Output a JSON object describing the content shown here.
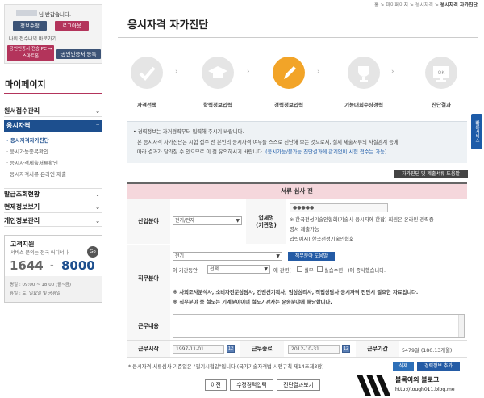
{
  "breadcrumb": [
    "홈",
    "마이페이지",
    "응시자격",
    "응시자격 자가진단"
  ],
  "sidebar": {
    "greeting_name": "●●●●●",
    "greeting_text": "님 반갑습니다.",
    "btn_edit_info": "정보수정",
    "btn_logout": "로그아웃",
    "recent_link": "나의 접수내역 바로가기",
    "btn_cert_transfer": "공인인증서 전송 PC → 스마트폰",
    "btn_cert_register": "공인인증서 등록",
    "mypage_title": "마이페이지",
    "menus": [
      {
        "label": "원서접수관리",
        "chev": "⌄"
      },
      {
        "label": "응시자격",
        "chev": "⌃"
      },
      {
        "label": "발급조회현황",
        "chev": "⌄"
      },
      {
        "label": "면제정보보기",
        "chev": "⌄"
      },
      {
        "label": "개인정보관리",
        "chev": "⌄"
      }
    ],
    "submenu": [
      "응시자격자가진단",
      "응시가능종목확인",
      "응시자격제출서류확인",
      "응시자격서류 온라인 제출"
    ],
    "cs_title": "고객지원",
    "cs_desc": "서비스 문의는 전국 어디서나",
    "cs_phone_a": "1644",
    "cs_phone_sep": "-",
    "cs_phone_b": "8000",
    "cs_badge": "Go",
    "cs_hours1": "평일 : 09:00 ~ 18:00 (월~금)",
    "cs_hours2": "휴일 : 토, 일요일 및 공휴일"
  },
  "page_title": "응시자격 자가진단",
  "steps": [
    {
      "label": "자격선택",
      "icon": "check-icon",
      "active": false
    },
    {
      "label": "학력정보입력",
      "icon": "graduation-cap-icon",
      "active": false
    },
    {
      "label": "경력정보입력",
      "icon": "pencil-icon",
      "active": true
    },
    {
      "label": "기능대회수상경력",
      "icon": "trophy-icon",
      "active": false
    },
    {
      "label": "진단결과",
      "icon": "monitor-ok-icon",
      "active": false
    }
  ],
  "step_ok_text": "OK",
  "notice": {
    "line1": "경력정보는 과거경력부터 입력해 주시기 바랍니다.",
    "line2": "본 응시자격 자가진단은 시험 접수 전 본인의 응시자격 여부를 스스로 진단해 보는 것으로서, 실제 제출서류의 사실관계 등에",
    "line3a": "따라 결과가 달라질 수 있으므로 이 점 유의하시기 바랍니다.",
    "line3b": "(응시가능/불가능 진단결과에 관계없이 시험 접수는 가능)"
  },
  "help_button": "자가진단 및 제출서류 도움말",
  "form": {
    "header": "서류 심사 전",
    "industry_label": "산업분야",
    "industry_value": "전기/전자",
    "employer_label": "업체명\n(기관명)",
    "employer_value": "●●●●●",
    "employer_note1": "※ 한국전성기술인협회(기술사 응시자에 한함) 회원은 온라인 경력증",
    "employer_note2": "명서 제출가능",
    "employer_note3": "입력예시) 한국전성기술인협회",
    "job_label": "직무분야",
    "job_value": "전기",
    "job_help_button": "직무분야 도움말",
    "job_period_prefix": "이 기간동안",
    "job_select_value": "선택",
    "job_related": "에 관련(",
    "opt_practice": "실무",
    "opt_assist": "실습수련",
    "job_suffix": ")에 종사했습니다.",
    "job_note1": "※ 사회조사분석사, 소비자전문상담사, 컨벤션기획사, 임상심리사, 직업상담사 응시자격 진단시 필요한 자료입니다.",
    "job_note2": "※ 직무분야 중 철도는 기계분야이며 철도기관사는 운송분야에 해당합니다.",
    "content_label": "근무내용",
    "start_label": "근무시작",
    "start_value": "1997-11-01",
    "end_label": "근무종료",
    "end_value": "2012-10-31",
    "period_label": "근무기간",
    "period_value": "5479일 (180.13개월)",
    "cal_icon_text": "12",
    "delete_button": "삭제",
    "add_button": "경력정보 추가",
    "footer_note": "* 응시자격 서류심사 기준일은 \"필기시험일\"입니다.(국가기술자격법 시행규칙 제14조제3항)"
  },
  "bottom": {
    "prev": "이전",
    "edit": "수정경력입력",
    "result": "진단결과보기"
  },
  "quick_tab": "빠른서비스",
  "watermark": {
    "title": "볼록이의 블로그",
    "url": "http://tough011.blog.me"
  },
  "colors": {
    "accent_orange": "#f2a428",
    "header_pink": "#f5d7dc",
    "navy": "#1d5ba8",
    "pink_btn": "#b3345b"
  }
}
